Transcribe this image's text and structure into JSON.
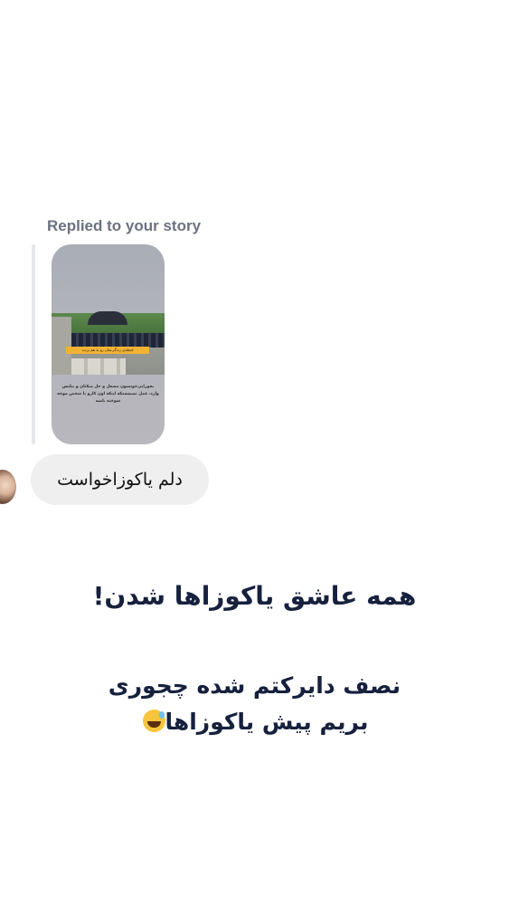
{
  "reply": {
    "label": "Replied to your story"
  },
  "story": {
    "banner_text": "لحظه‌ی زندگی‌شان رو به هم بردند",
    "caption_text": "بچورابی‌خونشون مشغل و حل میکنان و بیلیس وارد، عمل نمیشه‌مکه اینکه اون کارو با شخص موجه سوخته باشه"
  },
  "message": {
    "text": "دلم یاکوزاخواست"
  },
  "overlay": {
    "headline": "همه عاشق یاکوزاها شدن!",
    "line1": "نصف دایرکتم شده چجوری",
    "line2": "بریم پیش یاکوزاها",
    "emoji": "grinning-face-with-sweat-emoji"
  }
}
